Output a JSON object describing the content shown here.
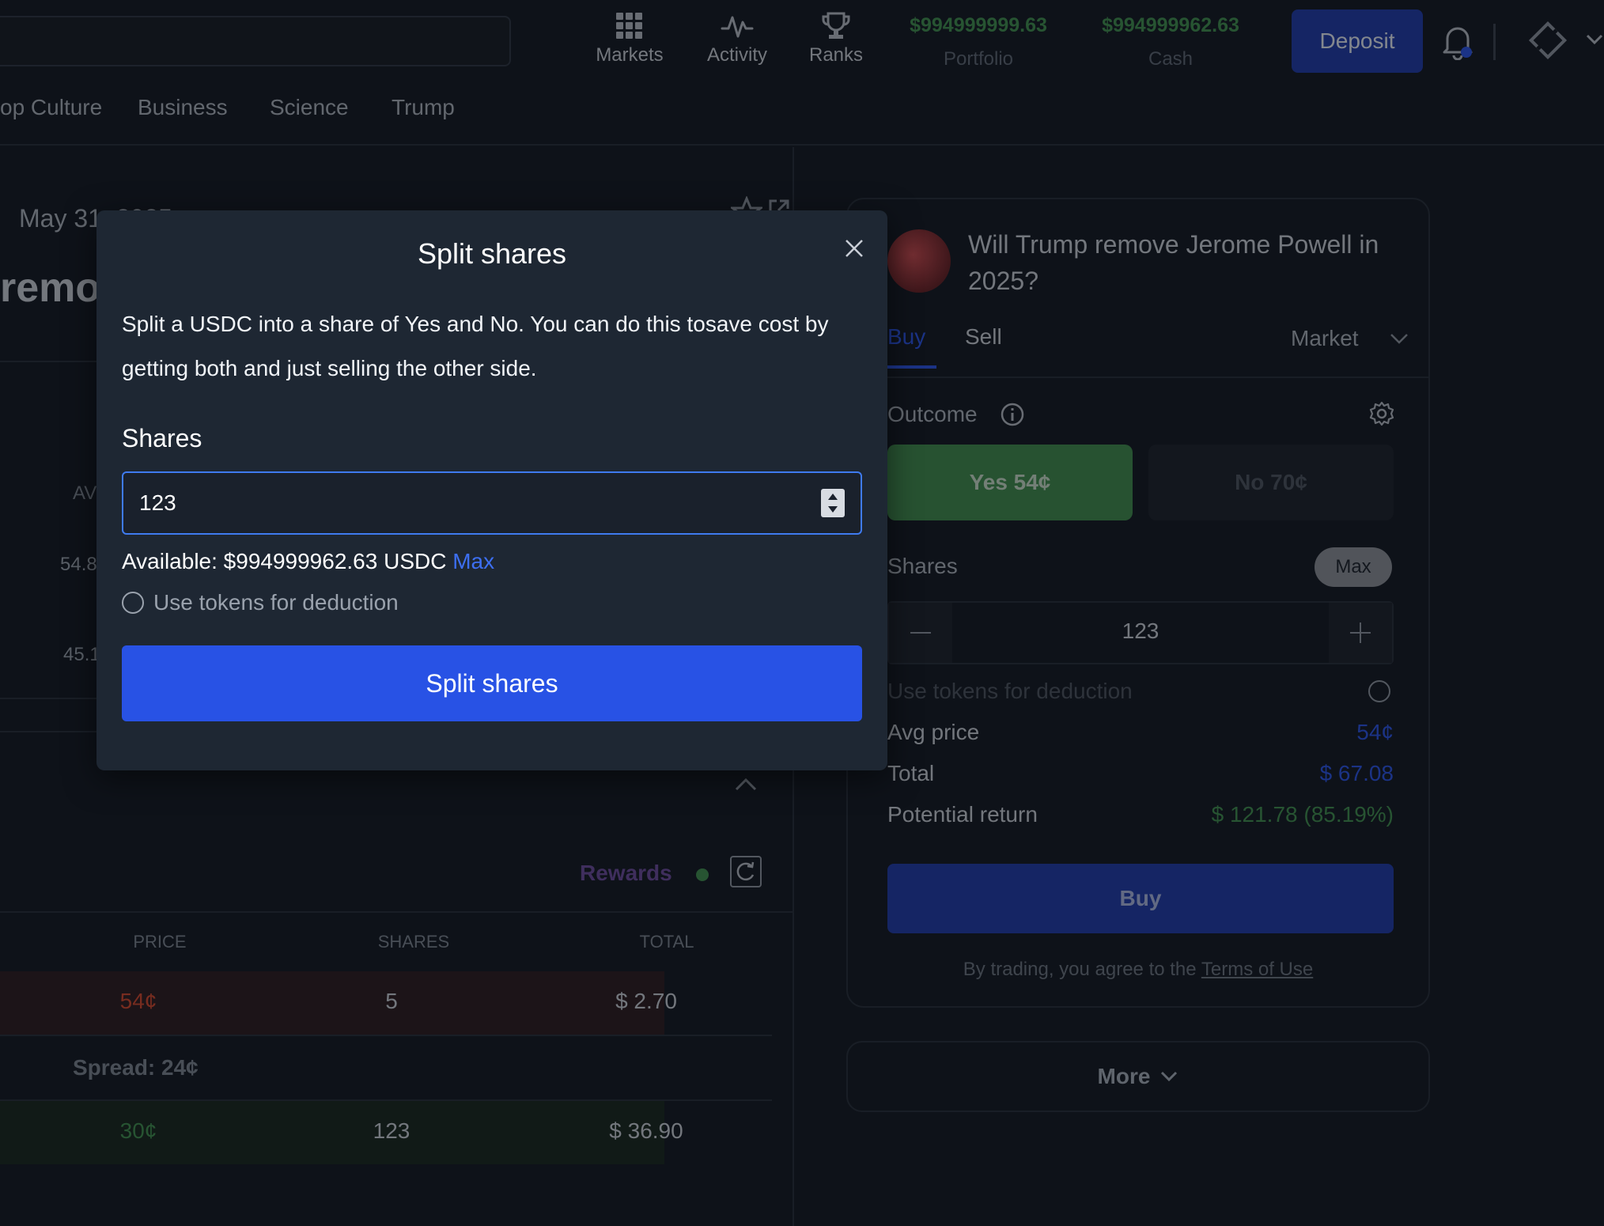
{
  "header": {
    "nav": [
      {
        "label": "Markets",
        "icon": "grid-icon"
      },
      {
        "label": "Activity",
        "icon": "activity-icon"
      },
      {
        "label": "Ranks",
        "icon": "trophy-icon"
      }
    ],
    "portfolio": {
      "value": "$994999999.63",
      "label": "Portfolio"
    },
    "cash": {
      "value": "$994999962.63",
      "label": "Cash"
    },
    "deposit_label": "Deposit",
    "categories": [
      "op Culture",
      "Business",
      "Science",
      "Trump"
    ]
  },
  "left": {
    "date": "May 31, 2025",
    "title_fragment": "remov",
    "col_fragment": "AV",
    "row_values": [
      "54.8",
      "45.1"
    ],
    "rewards_label": "Rewards",
    "orderbook": {
      "headers": [
        "PRICE",
        "SHARES",
        "TOTAL"
      ],
      "ask": {
        "price": "54¢",
        "shares": "5",
        "total": "$ 2.70"
      },
      "spread": "Spread: 24¢",
      "bid": {
        "price": "30¢",
        "shares": "123",
        "total": "$ 36.90"
      }
    }
  },
  "trade": {
    "question": "Will Trump remove Jerome Powell in 2025?",
    "tab_buy": "Buy",
    "tab_sell": "Sell",
    "order_type": "Market",
    "outcome_label": "Outcome",
    "yes_label": "Yes 54¢",
    "no_label": "No 70¢",
    "shares_label": "Shares",
    "max_label": "Max",
    "shares_value": "123",
    "use_tokens": "Use tokens for deduction",
    "avg_price_label": "Avg price",
    "avg_price_value": "54¢",
    "total_label": "Total",
    "total_value": "$ 67.08",
    "return_label": "Potential return",
    "return_value": "$ 121.78 (85.19%)",
    "buy_label": "Buy",
    "terms_prefix": "By trading, you agree to the",
    "terms_link": "Terms of Use",
    "more_label": "More"
  },
  "modal": {
    "title": "Split shares",
    "description": "Split a USDC into a share of Yes and No. You can do this tosave cost by getting both and just selling the other side.",
    "shares_label": "Shares",
    "shares_value": "123",
    "available_prefix": "Available: $994999962.63 USDC",
    "max_label": "Max",
    "use_tokens": "Use tokens for deduction",
    "split_button": "Split shares"
  },
  "colors": {
    "accent_blue": "#2852e5",
    "deposit_blue": "#1e3aa8",
    "green": "#3f8f4e",
    "red": "#d0452b",
    "rewards_purple": "#6a4a9c"
  }
}
